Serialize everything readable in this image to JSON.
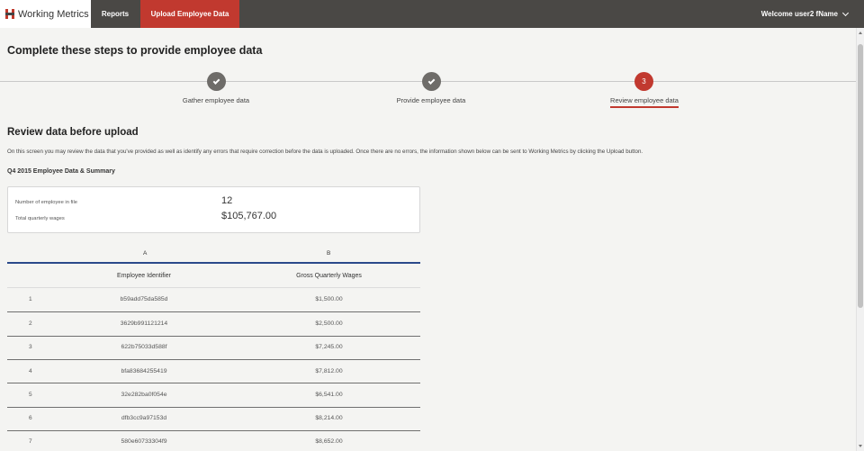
{
  "nav": {
    "brand": "Working Metrics",
    "reports": "Reports",
    "upload": "Upload Employee Data",
    "user": "Welcome user2 fName"
  },
  "page": {
    "title": "Complete these steps to provide employee data"
  },
  "steps": [
    {
      "label": "Gather employee data",
      "state": "done"
    },
    {
      "label": "Provide employee data",
      "state": "done"
    },
    {
      "label": "Review employee data",
      "state": "active",
      "number": "3"
    }
  ],
  "review": {
    "title": "Review data before upload",
    "description": "On this screen you may review the data that you've provided as well as identify any errors that require correction before the data is uploaded. Once there are no errors, the information shown below can be sent to Working Metrics by clicking the Upload button.",
    "summary_heading": "Q4 2015 Employee Data & Summary",
    "summary": {
      "employees_label": "Number of employee in file",
      "employees_value": "12",
      "wages_label": "Total quarterly wages",
      "wages_value": "$105,767.00"
    }
  },
  "table": {
    "col_letters": [
      "A",
      "B"
    ],
    "headers": [
      "Employee Identifier",
      "Gross Quarterly Wages"
    ],
    "rows": [
      {
        "idx": "1",
        "id": "b59add75da585d",
        "wages": "$1,500.00"
      },
      {
        "idx": "2",
        "id": "3629b991121214",
        "wages": "$2,500.00"
      },
      {
        "idx": "3",
        "id": "622b75033d588f",
        "wages": "$7,245.00"
      },
      {
        "idx": "4",
        "id": "bfa83684255419",
        "wages": "$7,812.00"
      },
      {
        "idx": "5",
        "id": "32e282ba0f054e",
        "wages": "$6,541.00"
      },
      {
        "idx": "6",
        "id": "dfb3cc9a97153d",
        "wages": "$8,214.00"
      },
      {
        "idx": "7",
        "id": "580e60733304f9",
        "wages": "$8,652.00"
      }
    ]
  },
  "colors": {
    "nav_bg": "#4a4845",
    "accent_red": "#c1392f",
    "table_rule": "#2b4a8b",
    "step_done": "#6e6c69"
  }
}
